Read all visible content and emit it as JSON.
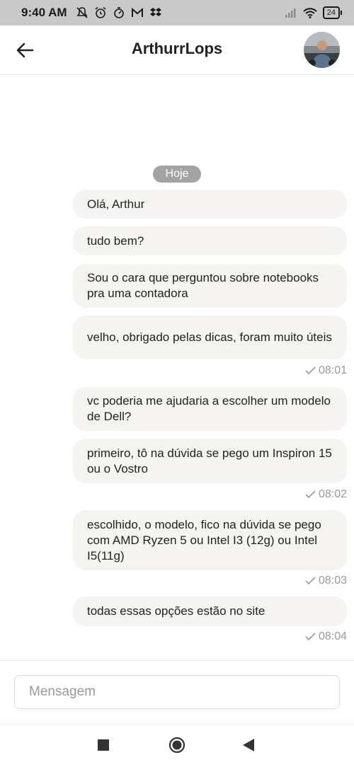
{
  "status_bar": {
    "time": "9:40 AM",
    "battery": "24",
    "left_icons": [
      "notifications-off-icon",
      "alarm-icon",
      "timer-icon",
      "gmail-icon",
      "dropbox-icon"
    ],
    "right_icons": [
      "signal-icon",
      "wifi-icon",
      "battery-icon"
    ]
  },
  "header": {
    "title": "ArthurrLops",
    "back_icon": "arrow-left-icon",
    "avatar": "contact-avatar"
  },
  "chat": {
    "day_label": "Hoje",
    "messages": [
      {
        "text": "Olá, Arthur"
      },
      {
        "text": "tudo bem?"
      },
      {
        "text": "Sou o cara que perguntou sobre notebooks pra uma contadora"
      },
      {
        "text": "velho, obrigado pelas dicas, foram muito úteis"
      },
      {
        "text": "vc poderia me ajudaria a escolher um modelo de Dell?"
      },
      {
        "text": "primeiro, tô na dúvida se pego um Inspiron 15 ou o Vostro"
      },
      {
        "text": "escolhido, o modelo, fico na dúvida se pego com AMD Ryzen 5 ou Intel I3 (12g) ou Intel I5(11g)"
      },
      {
        "text": "todas essas opções estão no site"
      }
    ],
    "timestamps": [
      "08:01",
      "08:02",
      "08:03",
      "08:04"
    ]
  },
  "composer": {
    "placeholder": "Mensagem",
    "value": ""
  },
  "nav_bar": {
    "icons": [
      "recents-square-icon",
      "home-circle-icon",
      "back-triangle-icon"
    ]
  },
  "colors": {
    "bubble": "#f6f4f0",
    "badge": "#a3a3a3",
    "status_bar": "#c9c9c9",
    "meta_text": "#9a9a9a"
  }
}
